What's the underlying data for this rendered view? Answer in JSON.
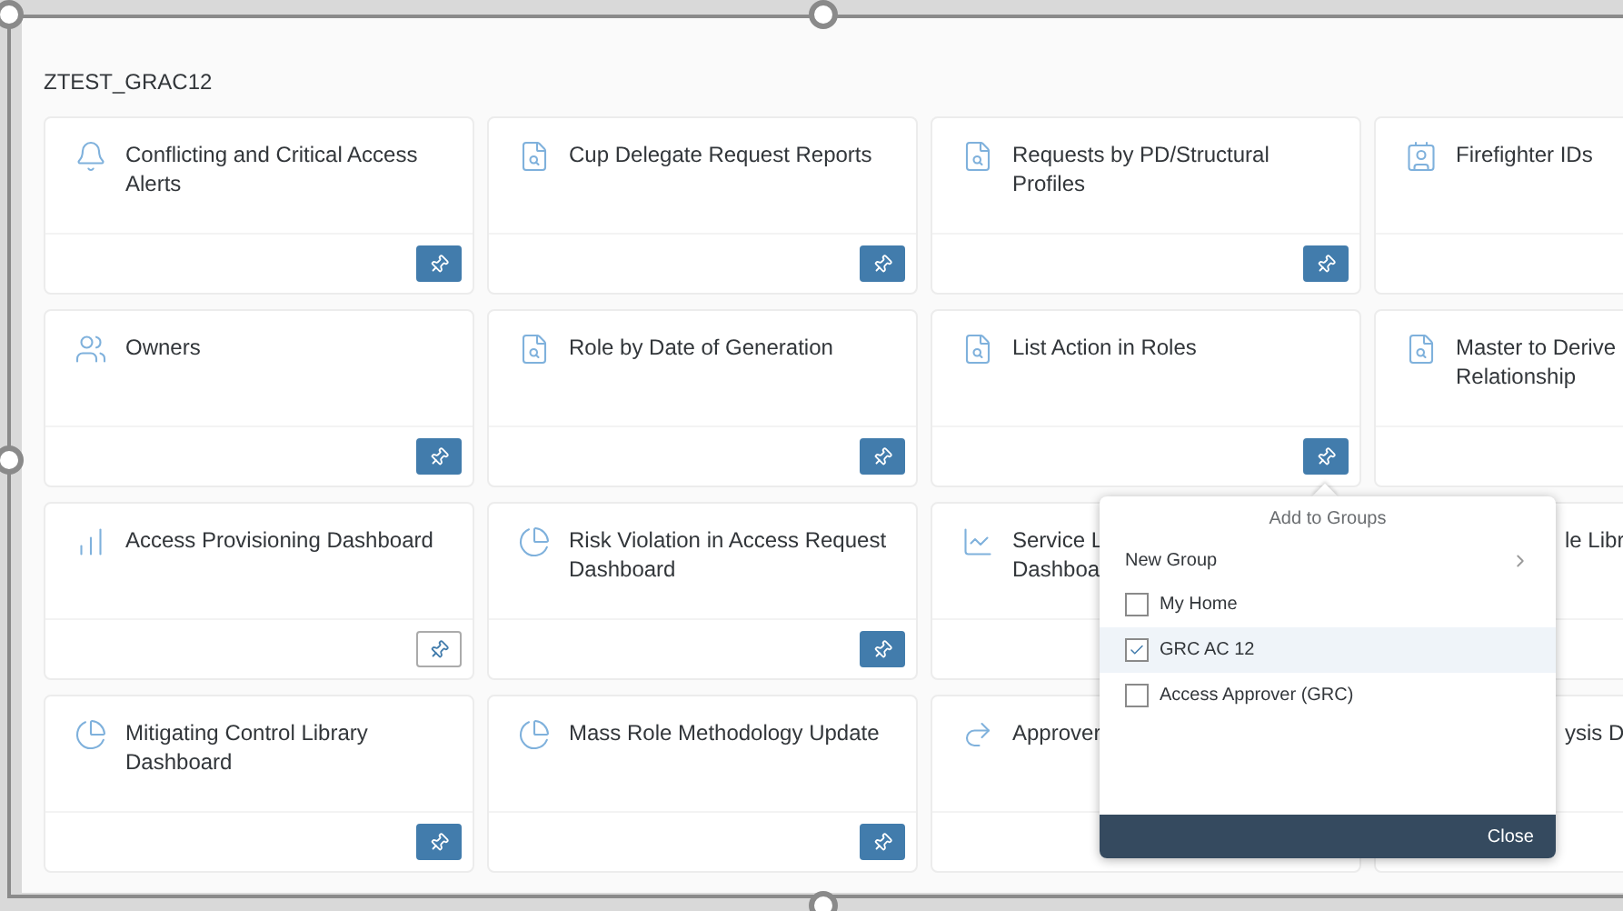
{
  "group_title": "ZTEST_GRAC12",
  "tiles": [
    {
      "kind": "alert",
      "title": "Conflicting and Critical Access\nAlerts",
      "pinned": true
    },
    {
      "kind": "report",
      "title": "Cup Delegate Request Reports",
      "pinned": true
    },
    {
      "kind": "report",
      "title": "Requests by PD/Structural\nProfiles",
      "pinned": true
    },
    {
      "kind": "firefighter",
      "title": "Firefighter IDs"
    },
    {
      "kind": "owners",
      "title": "Owners",
      "pinned": true
    },
    {
      "kind": "report",
      "title": "Role by Date of Generation",
      "pinned": true
    },
    {
      "kind": "report",
      "title": "List Action in Roles",
      "pinned": true
    },
    {
      "kind": "report",
      "title": "Master to Derive\nRelationship"
    },
    {
      "kind": "bars",
      "title": "Access Provisioning Dashboard",
      "pinned": false
    },
    {
      "kind": "pie",
      "title": "Risk Violation in Access Request\nDashboard",
      "pinned": true
    },
    {
      "kind": "trend",
      "title": "Service L\nDashboa"
    },
    {
      "kind": "covered",
      "title": "le Libr"
    },
    {
      "kind": "pie",
      "title": "Mitigating Control Library\nDashboard",
      "pinned": true
    },
    {
      "kind": "pie",
      "title": "Mass Role Methodology Update",
      "pinned": true
    },
    {
      "kind": "arrow",
      "title": "Approver"
    },
    {
      "kind": "covered",
      "title": "ysis D"
    }
  ],
  "popover": {
    "title": "Add to Groups",
    "new_group": "New Group",
    "groups": [
      {
        "label": "My Home",
        "checked": false,
        "selected": false
      },
      {
        "label": "GRC AC 12",
        "checked": true,
        "selected": true
      },
      {
        "label": "Access Approver (GRC)",
        "checked": false,
        "selected": false
      }
    ],
    "close": "Close"
  }
}
